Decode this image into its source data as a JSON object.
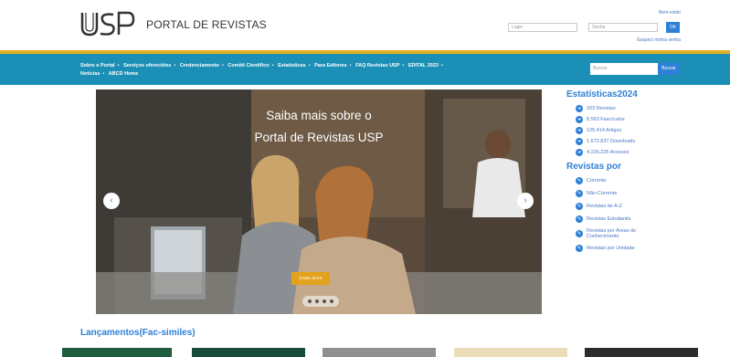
{
  "header": {
    "portal_title": "PORTAL DE REVISTAS",
    "welcome": "Bem-vindo",
    "login_placeholder": "Login",
    "password_placeholder": "Senha",
    "ok_label": "OK",
    "forgot_label": "Esqueci minha senha"
  },
  "nav": {
    "items_row1": [
      "Sobre o Portal",
      "Serviços oferecidos",
      "Credenciamento",
      "Comitê Científico",
      "Estatísticas",
      "Para Editores",
      "FAQ Revistas USP",
      "EDITAL 2023"
    ],
    "items_row2": [
      "Notícias",
      "ABCD Home"
    ],
    "search_placeholder": "Buscar",
    "search_button": "Buscar"
  },
  "carousel": {
    "line1": "Saiba mais sobre o",
    "line2": "Portal de Revistas USP",
    "button": "SAIBA MAIS",
    "prev": "‹",
    "next": "›"
  },
  "stats": {
    "title": "Estatísticas2024",
    "items": [
      "203 Revistas",
      "8.563 Fascículos",
      "125.414 Artigos",
      "1.672.837 Downloads",
      "4.226.226 Acessos"
    ]
  },
  "revistas": {
    "title": "Revistas por",
    "items": [
      "Corrente",
      "Não-Corrente",
      "Revistas de A-Z",
      "Revistas Estudantis",
      "Revistas por Áreas do Conhecimento",
      "Revistas por Unidade"
    ]
  },
  "lancamentos": {
    "title": "Lançamentos(Fac-similes)"
  },
  "colors": {
    "navbar": "#1b8fb5",
    "accent": "#2f80d8",
    "gold": "#e0b020"
  }
}
